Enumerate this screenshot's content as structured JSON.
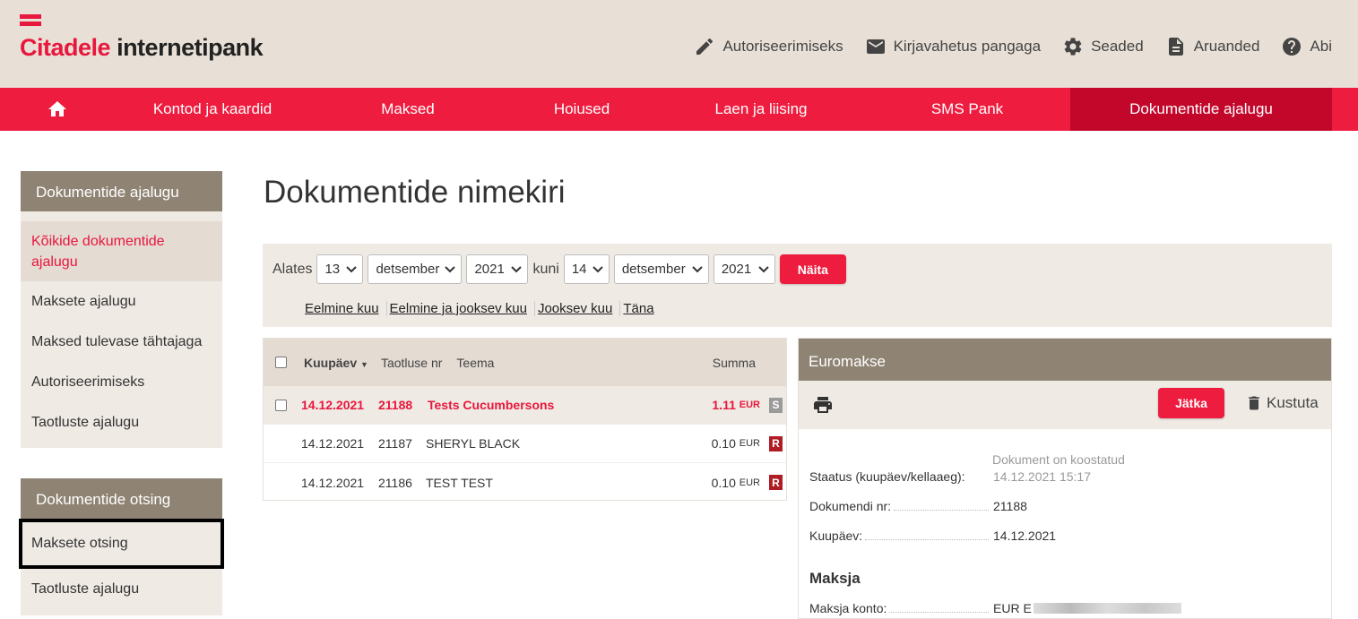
{
  "header": {
    "logo_brand": "Citadele",
    "logo_rest": "internetipank",
    "links": [
      {
        "label": "Autoriseerimiseks",
        "icon": "pencil-icon"
      },
      {
        "label": "Kirjavahetus pangaga",
        "icon": "mail-icon"
      },
      {
        "label": "Seaded",
        "icon": "gear-icon"
      },
      {
        "label": "Aruanded",
        "icon": "document-icon"
      },
      {
        "label": "Abi",
        "icon": "help-icon"
      }
    ]
  },
  "nav": {
    "items": [
      "Kontod ja kaardid",
      "Maksed",
      "Hoiused",
      "Laen ja liising",
      "SMS Pank",
      "Dokumentide ajalugu"
    ]
  },
  "sidebar": {
    "history": {
      "title": "Dokumentide ajalugu",
      "items": [
        "Kõikide dokumentide ajalugu",
        "Maksete ajalugu",
        "Maksed tulevase tähtajaga",
        "Autoriseerimiseks",
        "Taotluste ajalugu"
      ]
    },
    "search": {
      "title": "Dokumentide otsing",
      "items": [
        "Maksete otsing",
        "Taotluste ajalugu"
      ]
    }
  },
  "main": {
    "title": "Dokumentide nimekiri",
    "filter": {
      "from_label": "Alates",
      "to_label": "kuni",
      "from_day": "13",
      "from_month": "detsember",
      "from_year": "2021",
      "to_day": "14",
      "to_month": "detsember",
      "to_year": "2021",
      "show_button": "Näita",
      "quick_links": [
        "Eelmine kuu",
        "Eelmine ja jooksev kuu",
        "Jooksev kuu",
        "Täna"
      ]
    },
    "list": {
      "columns": {
        "date": "Kuupäev",
        "app_no": "Taotluse nr",
        "subject": "Teema",
        "sum": "Summa"
      },
      "rows": [
        {
          "date": "14.12.2021",
          "no": "21188",
          "subject": "Tests Cucumbersons",
          "amount": "1.11",
          "currency": "EUR",
          "badge": "S"
        },
        {
          "date": "14.12.2021",
          "no": "21187",
          "subject": "SHERYL BLACK",
          "amount": "0.10",
          "currency": "EUR",
          "badge": "R"
        },
        {
          "date": "14.12.2021",
          "no": "21186",
          "subject": "TEST TEST",
          "amount": "0.10",
          "currency": "EUR",
          "badge": "R"
        }
      ]
    },
    "detail": {
      "title": "Euromakse",
      "continue_button": "Jätka",
      "delete_label": "Kustuta",
      "status_label": "Staatus (kuupäev/kellaaeg):",
      "status_value": "Dokument on koostatud",
      "status_time": "14.12.2021 15:17",
      "doc_no_label": "Dokumendi nr:",
      "doc_no_value": "21188",
      "date_label": "Kuupäev:",
      "date_value": "14.12.2021",
      "payer_heading": "Maksja",
      "payer_account_label": "Maksja konto:",
      "payer_account_value": "EUR E"
    }
  },
  "colors": {
    "brand_red": "#ee1c3f",
    "nav_active": "#c2072b",
    "sidebar_head": "#8f8474",
    "beige": "#efeae4",
    "badge_grey": "#9a9a9a",
    "badge_red": "#b01c24"
  }
}
